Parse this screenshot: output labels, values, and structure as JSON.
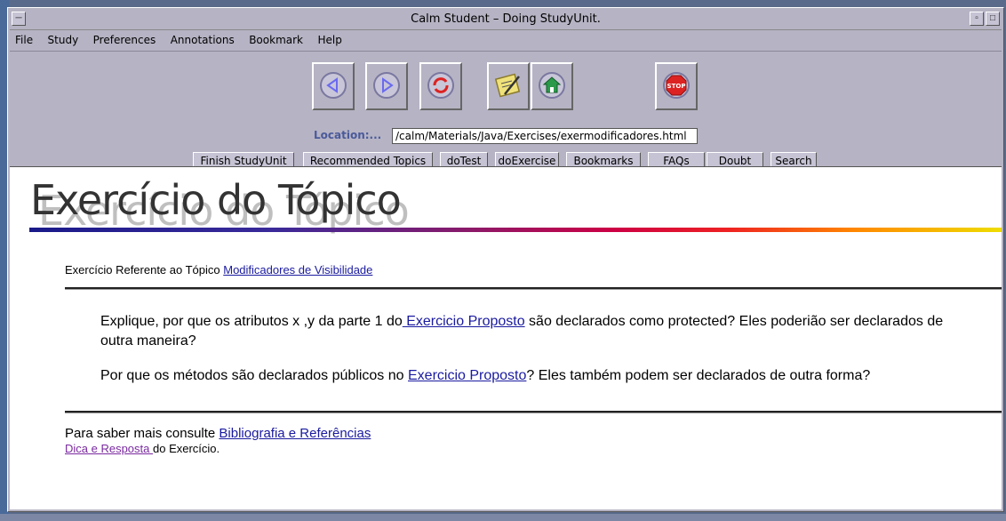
{
  "window": {
    "title": "Calm Student – Doing StudyUnit."
  },
  "menu": [
    "File",
    "Study",
    "Preferences",
    "Annotations",
    "Bookmark",
    "Help"
  ],
  "toolbar": {
    "icons": [
      "back-icon",
      "forward-icon",
      "reload-icon",
      "notepad-icon",
      "home-icon",
      "stop-icon"
    ]
  },
  "location": {
    "label": "Location:...",
    "value": "/calm/Materials/Java/Exercises/exermodificadores.html"
  },
  "nav_buttons": [
    "Finish StudyUnit",
    "Recommended Topics",
    "doTest",
    "doExercise",
    "Bookmarks",
    "FAQs",
    "Doubt",
    "Search"
  ],
  "page": {
    "heading": "Exercício do Tópico",
    "topic_prefix": "Exercício Referente ao Tópico ",
    "topic_link": " Modificadores de Visibilidade ",
    "q1_prefix": "Explique, por que os atributos x ,y da parte 1 do",
    "q1_link": " Exercicio Proposto",
    "q1_suffix": " são declarados como protected? Eles poderião ser declarados de outra maneira?",
    "q2_prefix": "Por que os métodos são declarados públicos no ",
    "q2_link": " Exercicio Proposto",
    "q2_suffix": "? Eles também podem ser declarados de outra forma?",
    "footer_prefix": "Para saber mais consulte ",
    "footer_link": "Bibliografia e Referências",
    "hint_link": "Dica e Resposta ",
    "hint_suffix": " do Exercício."
  },
  "colors": {
    "window_bg": "#b6b3c4",
    "link": "#1a1aa0",
    "visited_link": "#7a2aa0",
    "location_label": "#4a5a9a"
  }
}
